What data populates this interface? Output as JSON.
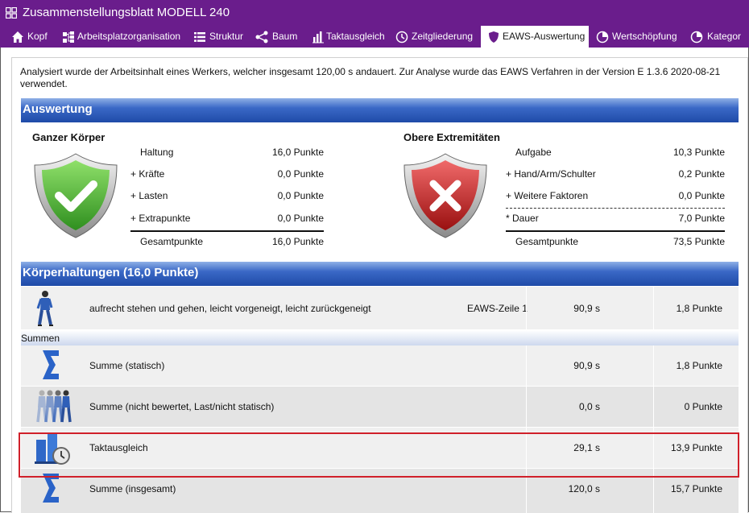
{
  "window": {
    "title": "Zusammenstellungsblatt MODELL 240",
    "accent": "#6a1d8c"
  },
  "tabs": [
    {
      "label": "Kopf",
      "icon": "home-icon"
    },
    {
      "label": "Arbeitsplatzorganisation",
      "icon": "organization-icon"
    },
    {
      "label": "Struktur",
      "icon": "list-icon"
    },
    {
      "label": "Baum",
      "icon": "share-tree-icon"
    },
    {
      "label": "Taktausgleich",
      "icon": "bar-chart-icon"
    },
    {
      "label": "Zeitgliederung",
      "icon": "clock-icon"
    },
    {
      "label": "EAWS-Auswertung",
      "icon": "shield-icon",
      "active": true
    },
    {
      "label": "Wertschöpfung",
      "icon": "pie-icon"
    },
    {
      "label": "Kategor",
      "icon": "pie-icon"
    }
  ],
  "intro": "Analysiert wurde der Arbeitsinhalt eines Werkers, welcher insgesamt 120,00 s andauert. Zur Analyse wurde das EAWS Verfahren in der Version E 1.3.6 2020-08-21 verwendet.",
  "auswertung": {
    "heading": "Auswertung",
    "ganzer_koerper": {
      "title": "Ganzer Körper",
      "status": "ok",
      "rows": [
        {
          "label": "Haltung",
          "value": "16,0 Punkte"
        },
        {
          "label": "+ Kräfte",
          "value": "0,0 Punkte"
        },
        {
          "label": "+ Lasten",
          "value": "0,0 Punkte"
        },
        {
          "label": "+ Extrapunkte",
          "value": "0,0 Punkte"
        }
      ],
      "total": {
        "label": "Gesamtpunkte",
        "value": "16,0 Punkte"
      }
    },
    "obere_extremitaeten": {
      "title": "Obere Extremitäten",
      "status": "fail",
      "rows": [
        {
          "label": "Aufgabe",
          "value": "10,3 Punkte"
        },
        {
          "label": "+ Hand/Arm/Schulter",
          "value": "0,2 Punkte"
        },
        {
          "label": "+ Weitere Faktoren",
          "value": "0,0 Punkte"
        },
        {
          "label": "* Dauer",
          "value": "7,0 Punkte"
        }
      ],
      "total": {
        "label": "Gesamtpunkte",
        "value": "73,5 Punkte"
      }
    }
  },
  "koerperhaltungen": {
    "heading": "Körperhaltungen (16,0 Punkte)",
    "rows": [
      {
        "icon": "walking-worker-icon",
        "desc": "aufrecht stehen und gehen, leicht vorgeneigt, leicht zurückgeneigt",
        "ref": "EAWS-Zeile 1",
        "sec": "90,9 s",
        "pts": "1,8 Punkte"
      }
    ]
  },
  "summen": {
    "label": "Summen",
    "rows": [
      {
        "icon": "sigma-icon",
        "desc": "Summe (statisch)",
        "sec": "90,9 s",
        "pts": "1,8 Punkte"
      },
      {
        "icon": "multiple-workers-icon",
        "desc": "Summe (nicht bewertet, Last/nicht statisch)",
        "sec": "0,0 s",
        "pts": "0 Punkte"
      },
      {
        "icon": "cycle-balance-icon",
        "desc": "Taktausgleich",
        "sec": "29,1 s",
        "pts": "13,9 Punkte"
      },
      {
        "icon": "sigma-icon",
        "desc": "Summe (insgesamt)",
        "sec": "120,0 s",
        "pts": "15,7 Punkte"
      }
    ]
  }
}
